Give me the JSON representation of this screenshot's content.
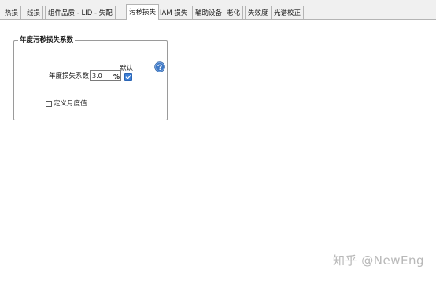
{
  "tabs": [
    {
      "label": "热损",
      "active": false
    },
    {
      "label": "线损",
      "active": false
    },
    {
      "label": "组件品质 - LID - 失配",
      "active": false
    },
    {
      "label": "污秽损失",
      "active": true
    },
    {
      "label": "IAM 损失",
      "active": false
    },
    {
      "label": "辅助设备",
      "active": false
    },
    {
      "label": "老化",
      "active": false
    },
    {
      "label": "失效度",
      "active": false
    },
    {
      "label": "光谱校正",
      "active": false
    }
  ],
  "soiling_group": {
    "title": "年度污秽损失系数",
    "factor_label": "年度损失系数",
    "factor_value": "3.0",
    "unit": "%",
    "default_label": "默认",
    "default_checked": true,
    "custom_monthly_label": "定义月度值",
    "custom_monthly_checked": false
  },
  "icons": {
    "help": "help-icon",
    "check": "check-icon"
  },
  "colors": {
    "accent": "#3c7fd6",
    "help_icon": "#3f79c6"
  },
  "watermark": "知乎 @NewEng"
}
